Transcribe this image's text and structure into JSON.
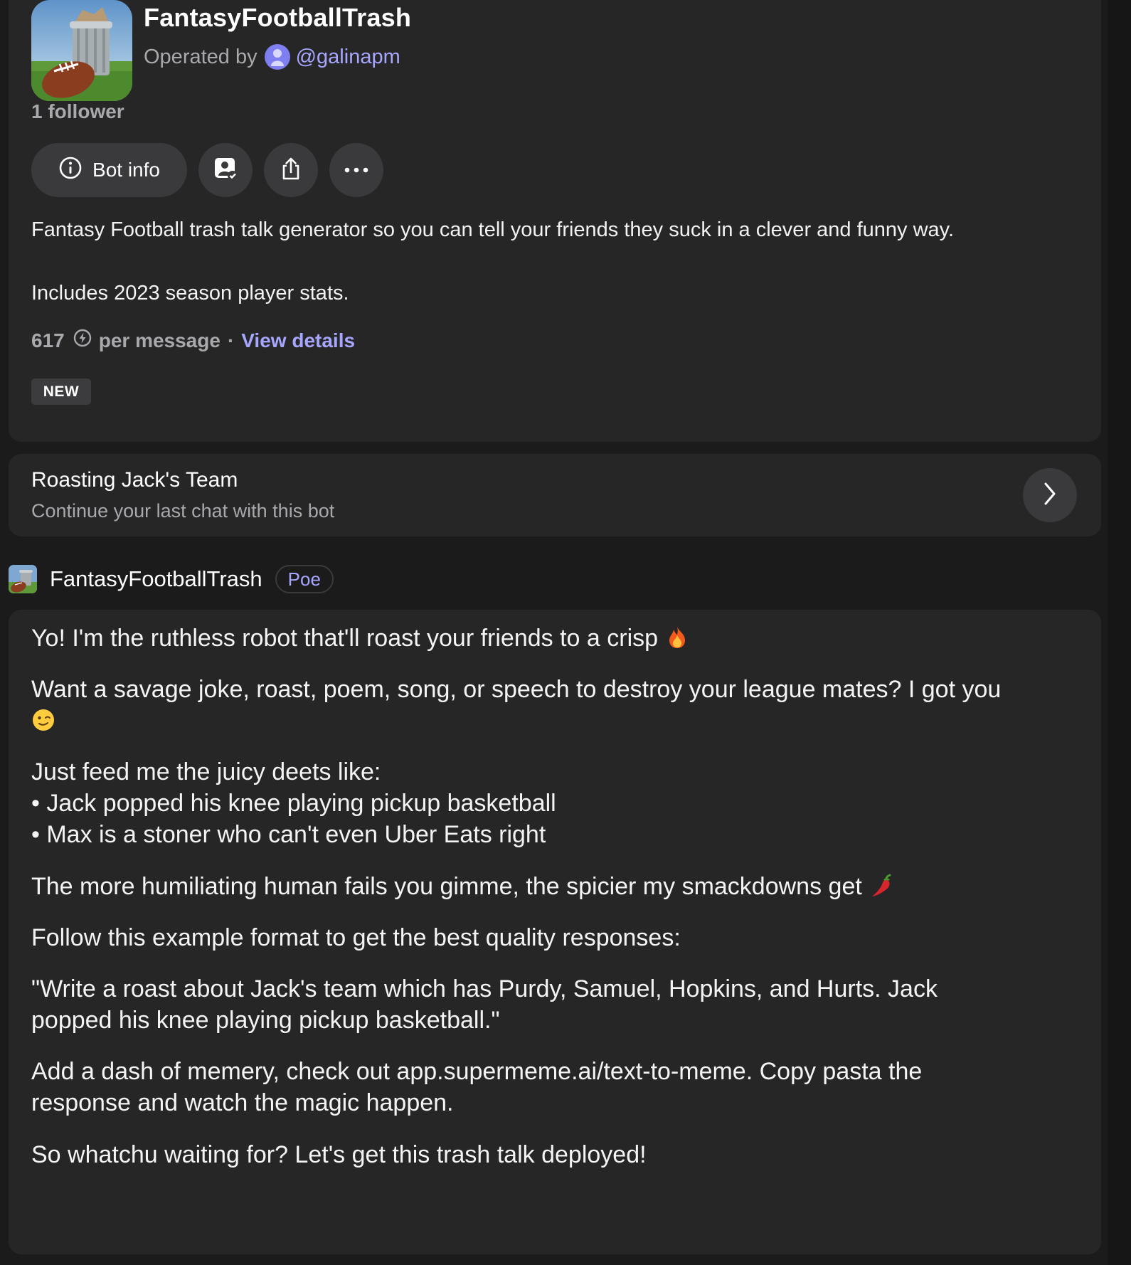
{
  "bot": {
    "name": "FantasyFootballTrash",
    "operated_by_label": "Operated by",
    "operator_handle": "@galinapm",
    "followers": "1 follower",
    "description_line1": "Fantasy Football trash talk generator so you can tell your friends they suck in a clever and funny way.",
    "description_line2": "Includes 2023 season player stats.",
    "cost_value": "617",
    "cost_unit": "per message",
    "cost_separator": "·",
    "view_details": "View details",
    "badge": "NEW"
  },
  "actions": {
    "bot_info_label": "Bot info",
    "icons": [
      "info-icon",
      "user-check-icon",
      "share-icon",
      "more-icon"
    ]
  },
  "continue_chat": {
    "title": "Roasting Jack's Team",
    "subtitle": "Continue your last chat with this bot",
    "icon": "chevron-right-icon"
  },
  "message": {
    "author": "FantasyFootballTrash",
    "author_badge": "Poe",
    "lines": {
      "l1": "Yo! I'm the ruthless robot that'll roast your friends to a crisp",
      "l2": "Want a savage joke, roast, poem, song, or speech to destroy your league mates? I got you",
      "l3": "Just feed me the juicy deets like:",
      "l4": "• Jack popped his knee playing pickup basketball",
      "l5": "• Max is a stoner who can't even Uber Eats right",
      "l6": "The more humiliating human fails you gimme, the spicier my smackdowns get",
      "l7": "Follow this example format to get the best quality responses:",
      "l8": "\"Write a roast about Jack's team which has Purdy, Samuel, Hopkins, and Hurts. Jack",
      "l9": "popped his knee playing pickup basketball.\"",
      "l10": "Add a dash of memery, check out app.supermeme.ai/text-to-meme. Copy pasta the",
      "l11": "response and watch the magic happen.",
      "l12": "So whatchu waiting for? Let's get this trash talk deployed!"
    },
    "emojis": [
      "fire-emoji",
      "wink-emoji",
      "chili-pepper-emoji"
    ]
  },
  "colors": {
    "background": "#1b1b1c",
    "card": "#262627",
    "button": "#3a3a3c",
    "accent": "#a6a6ff",
    "muted_text": "#a9a9ad"
  }
}
